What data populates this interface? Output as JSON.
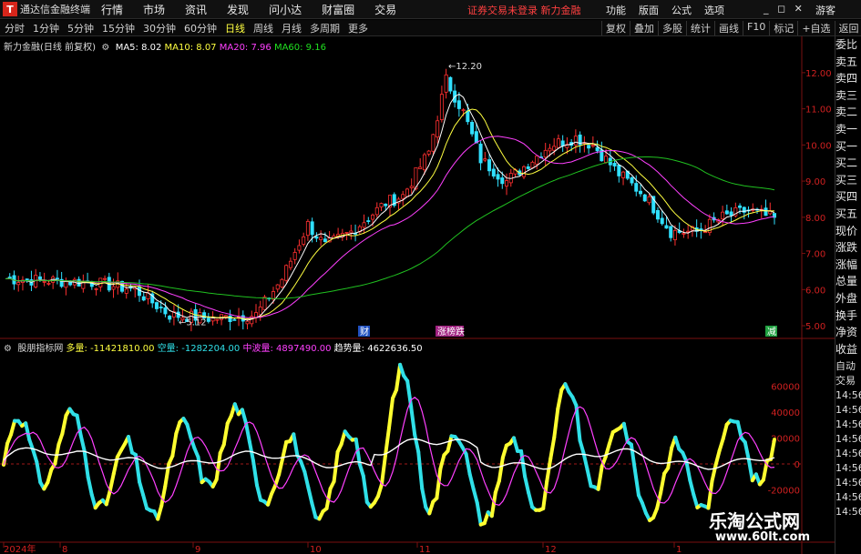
{
  "app": {
    "logo_char": "T",
    "title": "通达信金融终端"
  },
  "menu": [
    "行情",
    "市场",
    "资讯",
    "发现",
    "问小达",
    "财富圈",
    "交易"
  ],
  "notice": "证券交易未登录  新力金融",
  "right_menu": [
    "功能",
    "版面",
    "公式",
    "选项"
  ],
  "window_buttons": "_ ◻ ✕",
  "guest": "游客",
  "periods": [
    "分时",
    "1分钟",
    "5分钟",
    "15分钟",
    "30分钟",
    "60分钟",
    "日线",
    "周线",
    "月线",
    "多周期",
    "更多"
  ],
  "active_period": "日线",
  "tools": [
    "复权",
    "叠加",
    "多股",
    "统计",
    "画线",
    "F10",
    "标记",
    "+自选",
    "返回"
  ],
  "main_info": {
    "stock": "新力金融(日线 前复权)",
    "ma5": "MA5: 8.02",
    "ma10": "MA10: 8.07",
    "ma20": "MA20: 7.96",
    "ma60": "MA60: 9.16"
  },
  "sub_info": {
    "name": "股朋指标网",
    "duo": "多量: -11421810.00",
    "kong": "空量: -1282204.00",
    "zhongbo": "中波量: 4897490.00",
    "qushi": "趋势量: 4622636.50"
  },
  "price_axis": [
    "12.00",
    "11.00",
    "10.00",
    "9.00",
    "8.00",
    "7.00",
    "6.00",
    "5.00"
  ],
  "sub_axis": [
    "60000",
    "40000",
    "20000",
    "0",
    "-20000"
  ],
  "annotations": {
    "high": "12.20",
    "low": "5.12",
    "marker1": "财",
    "marker2": "涨榜跌",
    "marker3": "减"
  },
  "date_axis": [
    "2024年",
    "8",
    "9",
    "10",
    "11",
    "12",
    "1"
  ],
  "side_items": [
    "委比",
    "卖五",
    "卖四",
    "卖三",
    "卖二",
    "卖一",
    "买一",
    "买二",
    "买三",
    "买四",
    "买五",
    "现价",
    "涨跌",
    "涨幅",
    "总量",
    "外盘",
    "换手",
    "净资",
    "收益"
  ],
  "side_extra": [
    "自动",
    "交易",
    "14:56",
    "14:56",
    "14:56",
    "14:56",
    "14:56",
    "14:56",
    "14:56",
    "14:56",
    "14:56"
  ],
  "watermark": {
    "cn": "乐淘公式网",
    "url": "www.60lt.com"
  },
  "colors": {
    "up": "#ff3030",
    "down": "#30e0ff",
    "ma5": "#ffffff",
    "ma10": "#ffff40",
    "ma20": "#ff40ff",
    "ma60": "#20c020",
    "yellow_wave": "#ffff30",
    "cyan_wave": "#30e0e8"
  }
}
